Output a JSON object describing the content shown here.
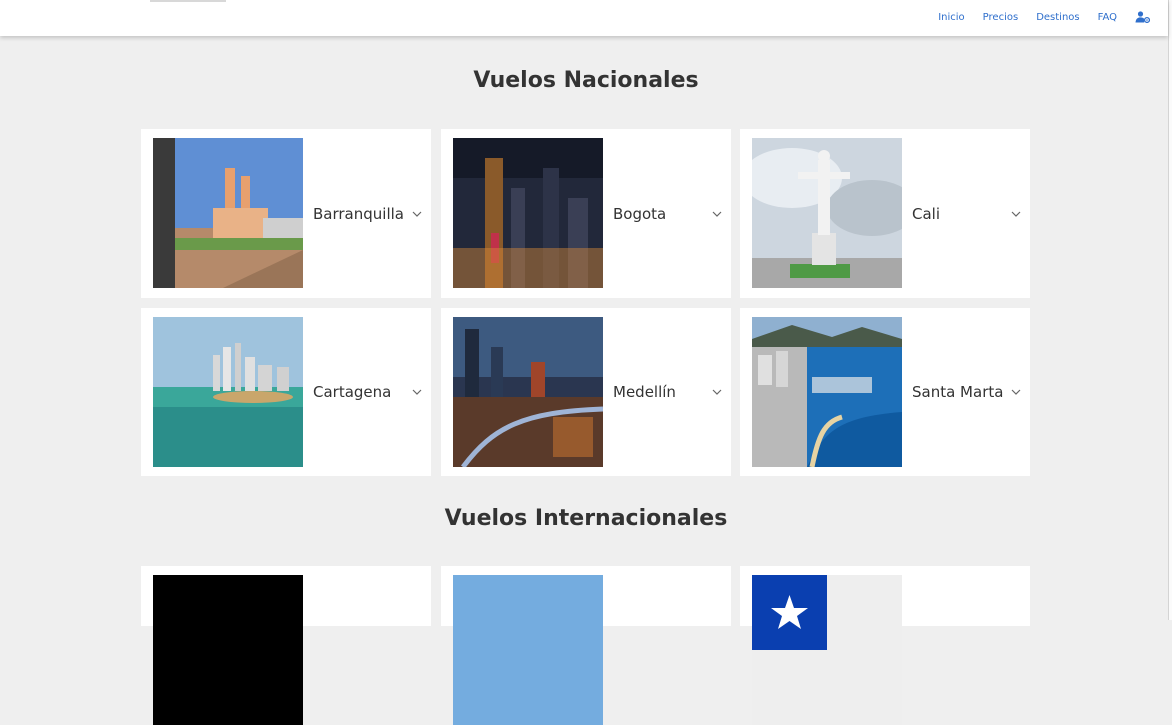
{
  "nav": {
    "items": [
      "Inicio",
      "Precios",
      "Destinos",
      "FAQ"
    ],
    "account_icon": "user-settings-icon"
  },
  "sections": {
    "national_title": "Vuelos Nacionales",
    "international_title": "Vuelos Internacionales"
  },
  "national": [
    {
      "name": "Barranquilla",
      "icon": "chevron-down-icon"
    },
    {
      "name": "Bogota",
      "icon": "chevron-down-icon"
    },
    {
      "name": "Cali",
      "icon": "chevron-down-icon"
    },
    {
      "name": "Cartagena",
      "icon": "chevron-down-icon"
    },
    {
      "name": "Medellín",
      "icon": "chevron-down-icon"
    },
    {
      "name": "Santa Marta",
      "icon": "chevron-down-icon"
    }
  ],
  "colors": {
    "accent": "#2f6fcc",
    "background": "#efefef",
    "card": "#ffffff",
    "text": "#333333"
  }
}
